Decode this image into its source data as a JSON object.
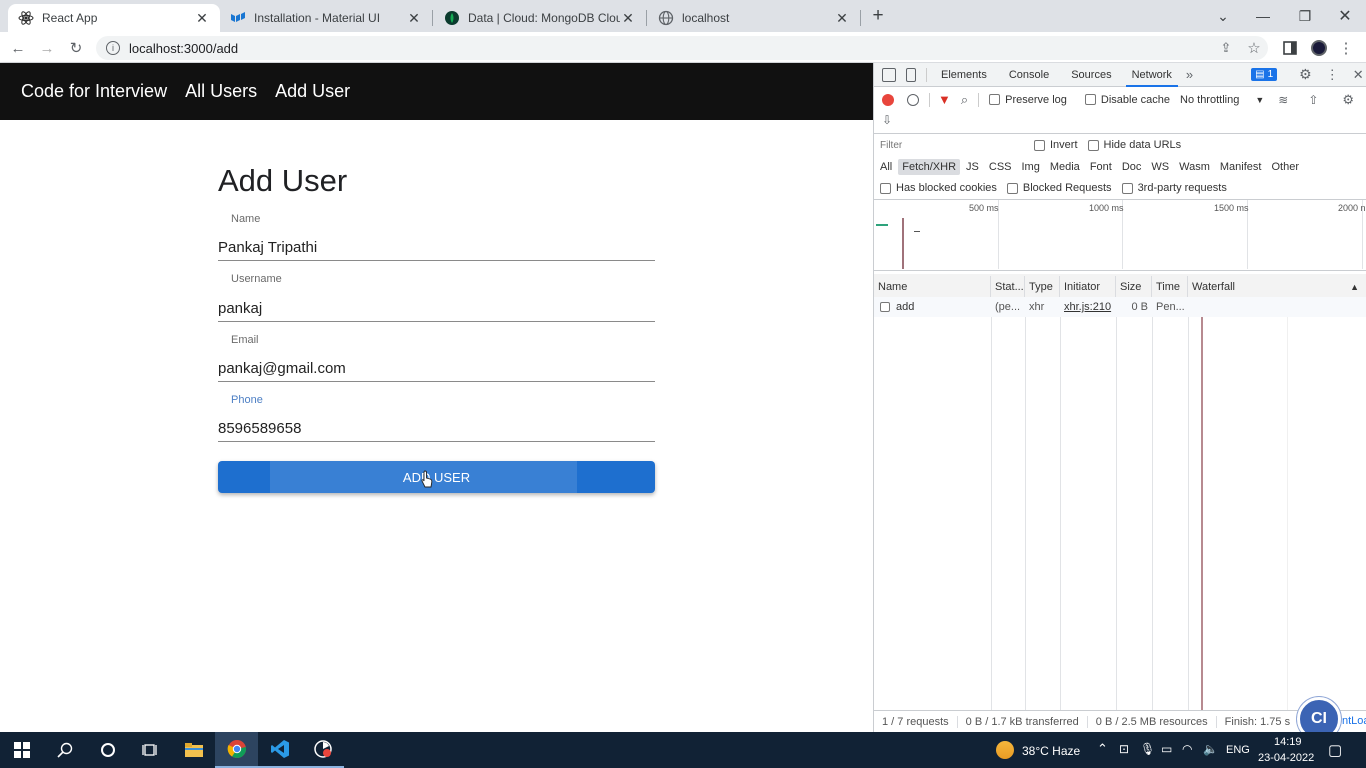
{
  "browser": {
    "tabs": [
      {
        "title": "React App",
        "active": true,
        "icon": "react-icon"
      },
      {
        "title": "Installation - Material UI",
        "active": false,
        "icon": "material-ui-icon"
      },
      {
        "title": "Data | Cloud: MongoDB Cloud",
        "active": false,
        "icon": "mongodb-leaf-icon"
      },
      {
        "title": "localhost",
        "active": false,
        "icon": "globe-icon"
      }
    ],
    "url": "localhost:3000/add"
  },
  "app": {
    "nav": [
      "Code for Interview",
      "All Users",
      "Add User"
    ],
    "form": {
      "title": "Add User",
      "fields": [
        {
          "label": "Name",
          "value": "Pankaj Tripathi"
        },
        {
          "label": "Username",
          "value": "pankaj"
        },
        {
          "label": "Email",
          "value": "pankaj@gmail.com"
        },
        {
          "label": "Phone",
          "value": "8596589658"
        }
      ],
      "submit_label": "ADD USER"
    }
  },
  "devtools": {
    "tabs": [
      "Elements",
      "Console",
      "Sources",
      "Network"
    ],
    "active_tab": "Network",
    "issues_count": "1",
    "toolbar": {
      "preserve_log": "Preserve log",
      "disable_cache": "Disable cache",
      "throttling": "No throttling"
    },
    "filter_placeholder": "Filter",
    "invert": "Invert",
    "hide_data_urls": "Hide data URLs",
    "types": [
      "All",
      "Fetch/XHR",
      "JS",
      "CSS",
      "Img",
      "Media",
      "Font",
      "Doc",
      "WS",
      "Wasm",
      "Manifest",
      "Other"
    ],
    "active_type": "Fetch/XHR",
    "blocked_cookies": "Has blocked cookies",
    "blocked_requests": "Blocked Requests",
    "third_party": "3rd-party requests",
    "overview_ticks": [
      "500 ms",
      "1000 ms",
      "1500 ms",
      "2000 n"
    ],
    "columns": [
      "Name",
      "Stat...",
      "Type",
      "Initiator",
      "Size",
      "Time",
      "Waterfall"
    ],
    "rows": [
      {
        "name": "add",
        "status": "(pe...",
        "type": "xhr",
        "initiator": "xhr.js:210",
        "size": "0 B",
        "time": "Pen..."
      }
    ],
    "status": {
      "requests": "1 / 7 requests",
      "transferred": "0 B / 1.7 kB transferred",
      "resources": "0 B / 2.5 MB resources",
      "finish": "Finish: 1.75 s",
      "dom": "DO",
      "dom_tail": "ntLoa"
    }
  },
  "taskbar": {
    "weather": "38°C  Haze",
    "lang": "ENG",
    "time": "14:19",
    "date": "23-04-2022"
  },
  "colors": {
    "appbar": "#111111",
    "button": "#1e6fcf",
    "taskbar": "#112235",
    "record": "#e8453c"
  }
}
